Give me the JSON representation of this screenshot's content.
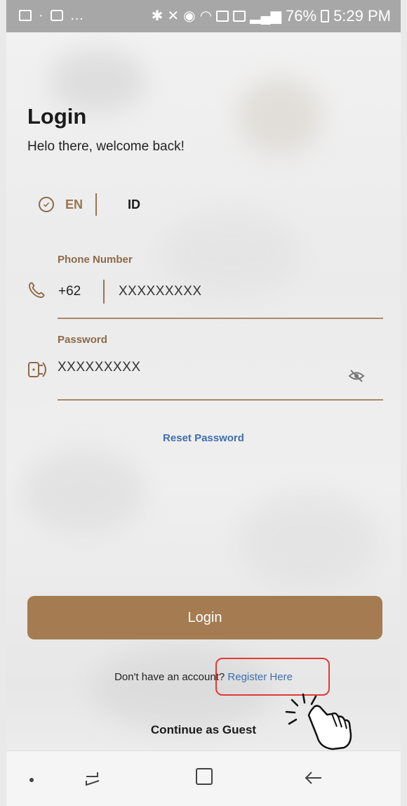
{
  "status_bar": {
    "battery": "76%",
    "time": "5:29 PM",
    "left_icons": [
      "image-icon",
      "briefcase-icon",
      "more-icon"
    ],
    "right_icons": [
      "bluetooth-icon",
      "mute-icon",
      "alarm-icon",
      "wifi-icon",
      "call-icon",
      "data-icon",
      "signal-icon",
      "charging-icon"
    ]
  },
  "header": {
    "title": "Login",
    "subtitle": "Helo there, welcome back!"
  },
  "language": {
    "selected": "EN",
    "other": "ID"
  },
  "phone": {
    "label": "Phone Number",
    "country_code": "+62",
    "value": "XXXXXXXXX"
  },
  "password": {
    "label": "Password",
    "value": "XXXXXXXXX"
  },
  "links": {
    "reset": "Reset Password",
    "register_prompt": "Don't have an account?",
    "register": "Register Here",
    "guest": "Continue as Guest"
  },
  "buttons": {
    "login": "Login"
  },
  "colors": {
    "accent": "#a57c52",
    "link": "#3f6fb0",
    "highlight": "#e53935"
  }
}
